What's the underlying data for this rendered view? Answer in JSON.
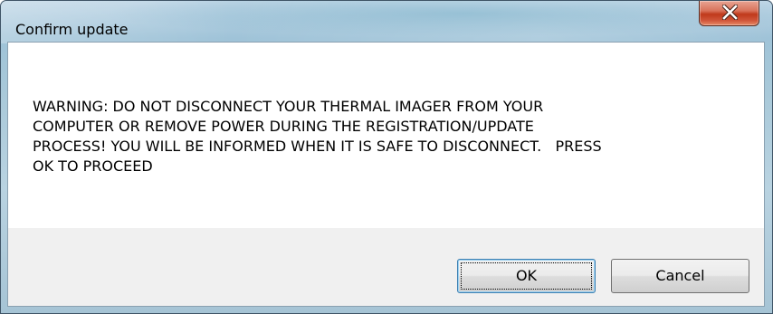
{
  "window": {
    "title": "Confirm update",
    "close_icon": "close-icon"
  },
  "dialog": {
    "message": "WARNING: DO NOT DISCONNECT YOUR THERMAL IMAGER FROM YOUR\nCOMPUTER OR REMOVE POWER DURING THE REGISTRATION/UPDATE\nPROCESS! YOU WILL BE INFORMED WHEN IT IS SAFE TO DISCONNECT.   PRESS\nOK TO PROCEED"
  },
  "buttons": {
    "ok_label": "OK",
    "cancel_label": "Cancel"
  },
  "colors": {
    "close_button": "#c7432a",
    "titlebar": "#a9c9d9",
    "default_button_border": "#3c7fb1"
  }
}
